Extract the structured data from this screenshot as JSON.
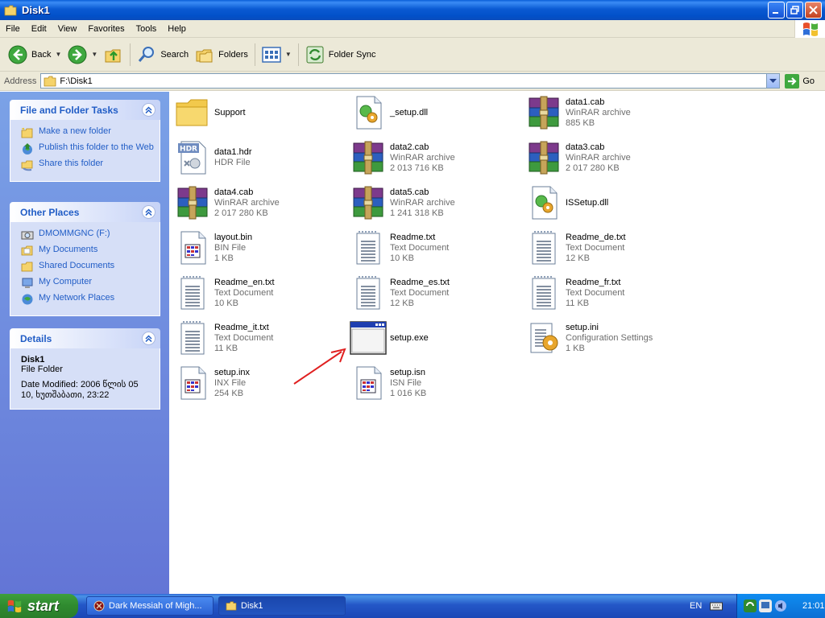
{
  "window": {
    "title": "Disk1"
  },
  "menu": [
    "File",
    "Edit",
    "View",
    "Favorites",
    "Tools",
    "Help"
  ],
  "toolbar": {
    "back": "Back",
    "search": "Search",
    "folders": "Folders",
    "folder_sync": "Folder Sync"
  },
  "address": {
    "label": "Address",
    "path": "F:\\Disk1",
    "go": "Go"
  },
  "tasks_panel": {
    "title": "File and Folder Tasks",
    "items": [
      "Make a new folder",
      "Publish this folder to the Web",
      "Share this folder"
    ]
  },
  "places_panel": {
    "title": "Other Places",
    "items": [
      "DMOMMGNC (F:)",
      "My Documents",
      "Shared Documents",
      "My Computer",
      "My Network Places"
    ]
  },
  "details_panel": {
    "title": "Details",
    "name": "Disk1",
    "type": "File Folder",
    "modified_1": "Date Modified: 2006 წლის 05",
    "modified_2": "10, ხუთშაბათი, 23:22"
  },
  "files": [
    {
      "name": "Support",
      "type": "",
      "size": "",
      "icon": "folder-icon"
    },
    {
      "name": "_setup.dll",
      "type": "",
      "size": "",
      "icon": "dll-icon"
    },
    {
      "name": "data1.cab",
      "type": "WinRAR archive",
      "size": "885 KB",
      "icon": "winrar-icon"
    },
    {
      "name": "data1.hdr",
      "type": "HDR File",
      "size": "",
      "icon": "hdr-icon"
    },
    {
      "name": "data2.cab",
      "type": "WinRAR archive",
      "size": "2 013 716 KB",
      "icon": "winrar-icon"
    },
    {
      "name": "data3.cab",
      "type": "WinRAR archive",
      "size": "2 017 280 KB",
      "icon": "winrar-icon"
    },
    {
      "name": "data4.cab",
      "type": "WinRAR archive",
      "size": "2 017 280 KB",
      "icon": "winrar-icon"
    },
    {
      "name": "data5.cab",
      "type": "WinRAR archive",
      "size": "1 241 318 KB",
      "icon": "winrar-icon"
    },
    {
      "name": "ISSetup.dll",
      "type": "",
      "size": "",
      "icon": "dll-icon"
    },
    {
      "name": "layout.bin",
      "type": "BIN File",
      "size": "1 KB",
      "icon": "generic-file-icon"
    },
    {
      "name": "Readme.txt",
      "type": "Text Document",
      "size": "10 KB",
      "icon": "text-document-icon"
    },
    {
      "name": "Readme_de.txt",
      "type": "Text Document",
      "size": "12 KB",
      "icon": "text-document-icon"
    },
    {
      "name": "Readme_en.txt",
      "type": "Text Document",
      "size": "10 KB",
      "icon": "text-document-icon"
    },
    {
      "name": "Readme_es.txt",
      "type": "Text Document",
      "size": "12 KB",
      "icon": "text-document-icon"
    },
    {
      "name": "Readme_fr.txt",
      "type": "Text Document",
      "size": "11 KB",
      "icon": "text-document-icon"
    },
    {
      "name": "Readme_it.txt",
      "type": "Text Document",
      "size": "11 KB",
      "icon": "text-document-icon"
    },
    {
      "name": "setup.exe",
      "type": "",
      "size": "",
      "icon": "application-icon"
    },
    {
      "name": "setup.ini",
      "type": "Configuration Settings",
      "size": "1 KB",
      "icon": "config-settings-icon"
    },
    {
      "name": "setup.inx",
      "type": "INX File",
      "size": "254 KB",
      "icon": "generic-file-icon"
    },
    {
      "name": "setup.isn",
      "type": "ISN File",
      "size": "1 016 KB",
      "icon": "generic-file-icon"
    }
  ],
  "taskbar": {
    "start": "start",
    "tasks": [
      "Dark Messiah of Migh...",
      "Disk1"
    ],
    "language": "EN",
    "clock": "21:01"
  },
  "colors": {
    "titlebar": "#0a5ad3",
    "task_link": "#215dc6",
    "annotation_arrow": "#e02020",
    "start_green": "#3e9f3e"
  }
}
